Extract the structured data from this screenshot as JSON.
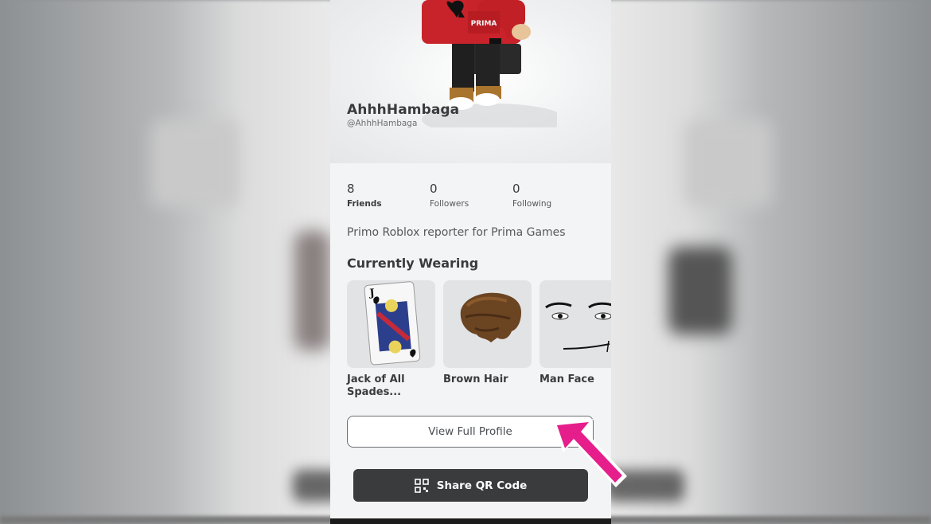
{
  "profile": {
    "display_name": "AhhhHambaga",
    "username": "@AhhhHambaga",
    "bio": "Primo Roblox reporter for Prima Games"
  },
  "stats": [
    {
      "value": "8",
      "label": "Friends"
    },
    {
      "value": "0",
      "label": "Followers"
    },
    {
      "value": "0",
      "label": "Following"
    }
  ],
  "wearing": {
    "title": "Currently Wearing",
    "items": [
      {
        "name": "Jack of All Spades...",
        "icon": "jack-of-spades-card"
      },
      {
        "name": "Brown Hair",
        "icon": "brown-hair"
      },
      {
        "name": "Man Face",
        "icon": "man-face"
      }
    ]
  },
  "actions": {
    "view_full_profile": "View Full Profile",
    "share_qr_code": "Share QR Code"
  },
  "shirt_text": "PRIMA",
  "colors": {
    "accent_arrow": "#e61e8c",
    "primary_button": "#393b3d",
    "panel_background": "#f3f4f5"
  }
}
